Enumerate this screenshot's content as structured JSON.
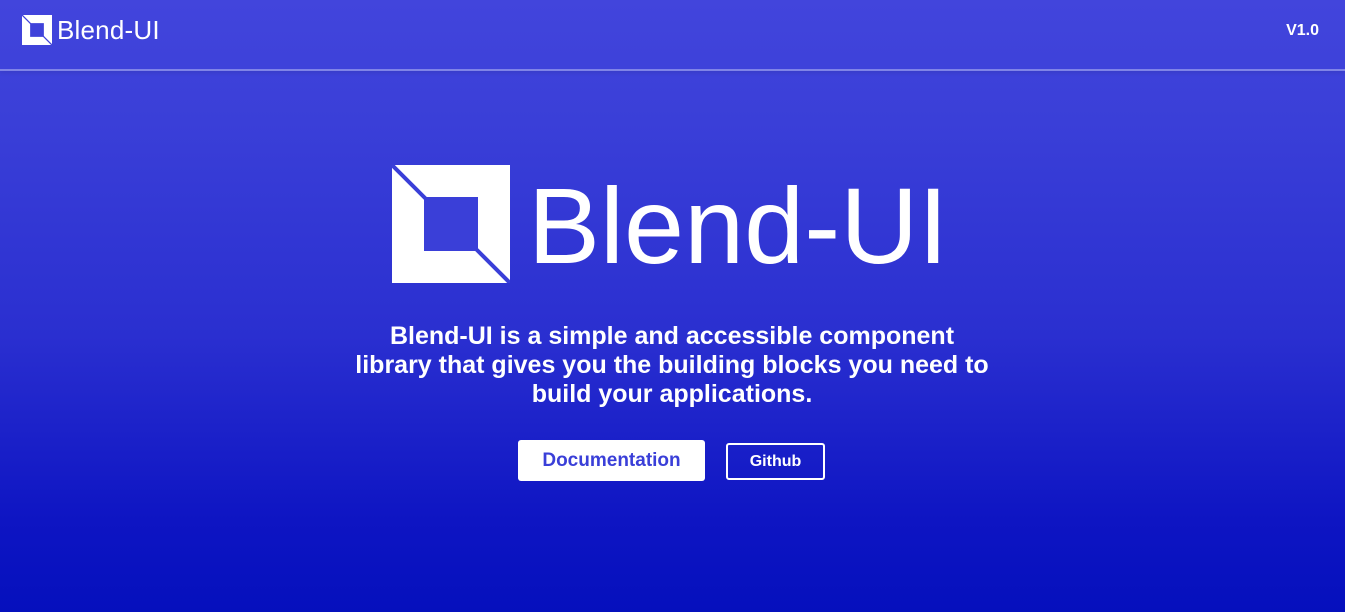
{
  "navbar": {
    "brand_name": "Blend-UI",
    "brand_icon": "blend-ui-logo-icon",
    "version": "V1.0"
  },
  "hero": {
    "title": "Blend-UI",
    "logo_icon": "blend-ui-logo-icon",
    "tagline": "Blend-UI is a simple and accessible component library that gives you the building blocks you need to build your applications."
  },
  "actions": {
    "documentation_label": "Documentation",
    "github_label": "Github"
  },
  "colors": {
    "background_top": "#4245dc",
    "background_bottom": "#0510bd",
    "accent": "#3a3fd8",
    "text": "#ffffff"
  }
}
